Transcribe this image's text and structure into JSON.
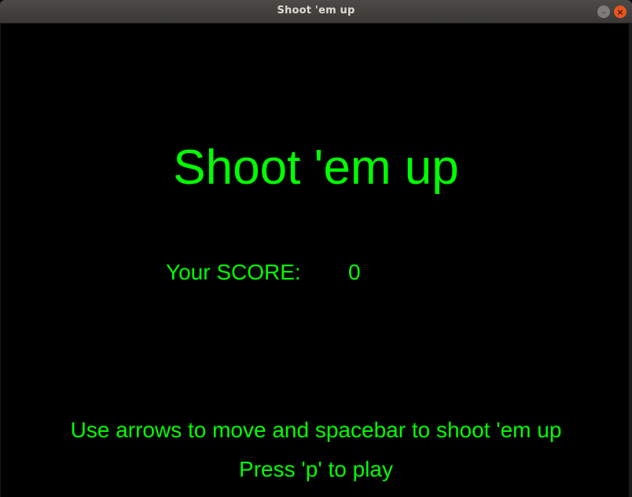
{
  "window": {
    "title": "Shoot 'em up",
    "minimize_glyph": "–",
    "close_glyph": "×"
  },
  "game": {
    "title": "Shoot 'em up",
    "score_label": "Your SCORE:",
    "score_value": "0",
    "instructions": "Use arrows to move and spacebar to shoot 'em up",
    "play_prompt": "Press 'p' to play"
  },
  "colors": {
    "text": "#00ff00",
    "background": "#000000",
    "titlebar": "#3f3e3a",
    "close_button": "#e95420"
  },
  "icons": {
    "minimize": "minimize-icon",
    "close": "close-icon"
  }
}
